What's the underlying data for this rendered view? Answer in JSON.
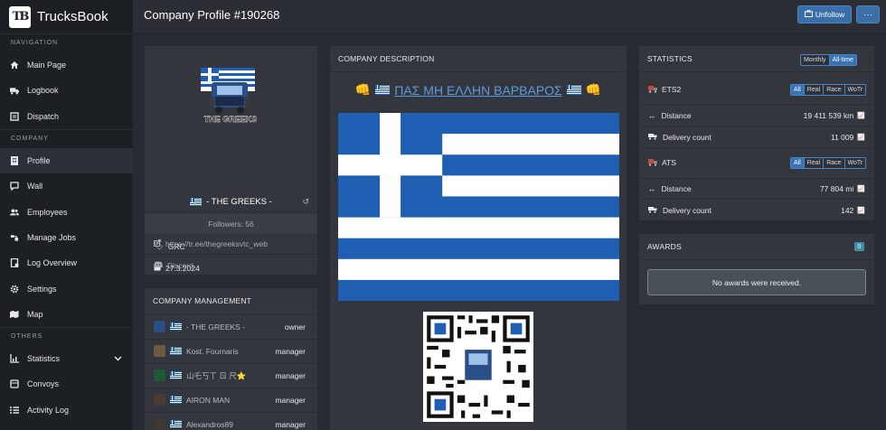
{
  "brand": {
    "name": "TrucksBook",
    "logo_text": "TB"
  },
  "header": {
    "title": "Company Profile #190268",
    "unfollow_label": "Unfollow",
    "more_label": "···"
  },
  "sidebar": {
    "sections": [
      {
        "title": "NAVIGATION",
        "items": [
          {
            "label": "Main Page",
            "icon": "home-icon"
          },
          {
            "label": "Logbook",
            "icon": "truck-icon"
          },
          {
            "label": "Dispatch",
            "icon": "clipboard-icon"
          }
        ]
      },
      {
        "title": "COMPANY",
        "items": [
          {
            "label": "Profile",
            "icon": "building-icon",
            "active": true
          },
          {
            "label": "Wall",
            "icon": "comment-icon"
          },
          {
            "label": "Employees",
            "icon": "users-icon"
          },
          {
            "label": "Manage Jobs",
            "icon": "jobs-icon"
          },
          {
            "label": "Log Overview",
            "icon": "log-icon"
          },
          {
            "label": "Settings",
            "icon": "gear-icon"
          },
          {
            "label": "Map",
            "icon": "map-icon"
          }
        ]
      },
      {
        "title": "OTHERS",
        "items": [
          {
            "label": "Statistics",
            "icon": "chart-icon",
            "expandable": true
          },
          {
            "label": "Convoys",
            "icon": "convoy-icon"
          },
          {
            "label": "Activity Log",
            "icon": "list-icon"
          }
        ]
      }
    ]
  },
  "profile": {
    "name": "- THE GREEKS -",
    "followers": "Followers: 56",
    "tag": "GRC",
    "date": "27.3.2024",
    "link": "https://tr.ee/thegreeksvtc_web",
    "discord": "Discord",
    "logo_text": "THE GREEKS"
  },
  "management": {
    "title": "COMPANY MANAGEMENT",
    "members": [
      {
        "name": "- THE GREEKS -",
        "role": "owner"
      },
      {
        "name": "Kost. Fournaris",
        "role": "manager"
      },
      {
        "name": "山乇丂ㄒ ㄖ 尺⭐",
        "role": "manager"
      },
      {
        "name": "AIRON MAN",
        "role": "manager"
      },
      {
        "name": "Alexandros89",
        "role": "manager"
      }
    ]
  },
  "description": {
    "title": "COMPANY DESCRIPTION",
    "headline": "ΠΑΣ ΜΗ ΕΛΛΗΝ ΒΑΡΒΑΡΟΣ",
    "emoji": "👊"
  },
  "stats": {
    "title": "STATISTICS",
    "period_options": [
      "Monthly",
      "All-time"
    ],
    "period_selected": "All-time",
    "filter_options": [
      "All",
      "Real",
      "Race",
      "WoTr"
    ],
    "games": [
      {
        "name": "ETS2",
        "distance_label": "Distance",
        "distance": "19 411 539 km",
        "delivery_label": "Delivery count",
        "deliveries": "11 009"
      },
      {
        "name": "ATS",
        "distance_label": "Distance",
        "distance": "77 804 mi",
        "delivery_label": "Delivery count",
        "deliveries": "142"
      }
    ]
  },
  "awards": {
    "title": "AWARDS",
    "count": "0",
    "empty_text": "No awards were received."
  },
  "colors": {
    "accent": "#3a6ea8",
    "link": "#5c9be0",
    "greek_blue": "#1e5fb4"
  }
}
